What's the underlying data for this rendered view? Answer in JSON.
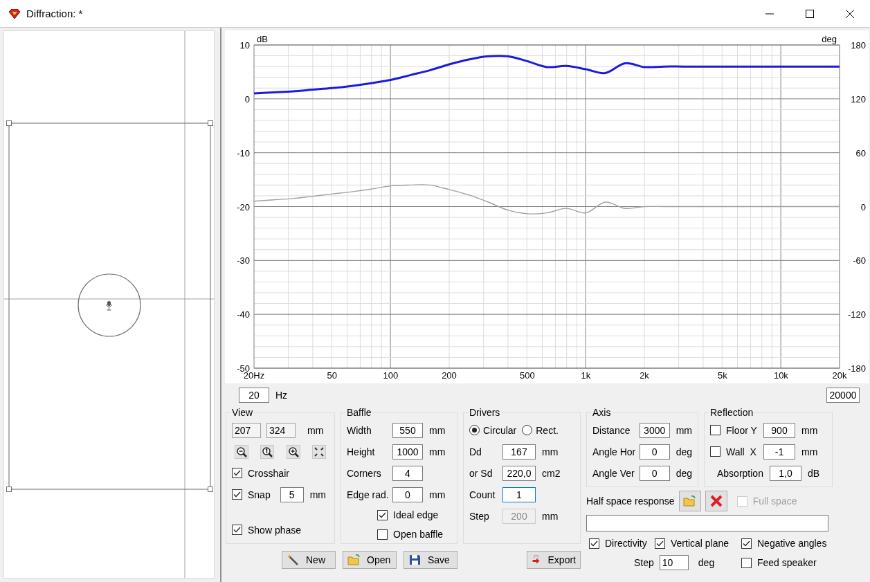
{
  "window": {
    "title": "Diffraction: *"
  },
  "chart": {
    "chart_data": {
      "type": "line",
      "grid": true,
      "ylabel": "dB",
      "y2label": "deg",
      "categories": [
        "20Hz",
        null,
        null,
        null,
        "50",
        null,
        null,
        "100",
        null,
        null,
        "200",
        null,
        null,
        null,
        "500",
        null,
        null,
        "1k",
        null,
        null,
        "2k",
        null,
        null,
        null,
        "5k",
        null,
        null,
        "10k",
        null,
        null,
        "20k"
      ],
      "series": [
        {
          "color": "#1a1ae0",
          "values": [
            1,
            1.2,
            1.4,
            1.7,
            2,
            2.4,
            2.9,
            3.5,
            4.4,
            5.3,
            6.4,
            7.3,
            7.9,
            7.9,
            7,
            5.9,
            6.1,
            5.5,
            4.8,
            6.6,
            5.9,
            6,
            6,
            6,
            6,
            6,
            6,
            6,
            6,
            6,
            6
          ]
        },
        {
          "color": "#a0a0a0",
          "axis": "y2",
          "values": [
            6,
            7.5,
            9,
            11.5,
            14,
            16.5,
            19.5,
            23,
            24,
            24,
            19,
            13,
            5,
            -4,
            -8,
            -7,
            -2,
            -7,
            5,
            -2,
            0,
            0,
            0,
            0,
            0,
            0,
            0,
            0,
            0,
            0,
            0
          ]
        }
      ],
      "ylim": [
        -50,
        10
      ],
      "y2lim": [
        -180,
        180
      ],
      "yticks": [
        10,
        0,
        -10,
        -20,
        -30,
        -40,
        -50
      ],
      "y2ticks": [
        180,
        120,
        60,
        0,
        -60,
        -120,
        -180
      ]
    }
  },
  "range": {
    "from": "20",
    "unit": "Hz",
    "to": "20000"
  },
  "groups": [
    {
      "title": "View",
      "rows": [
        {
          "kind": "pair",
          "values": [
            "207",
            "324"
          ],
          "unit": "mm"
        },
        {
          "kind": "tools"
        },
        {
          "kind": "check",
          "label": "Crosshair",
          "checked": true
        },
        {
          "kind": "check",
          "label": "Snap",
          "checked": true,
          "value": "5",
          "unit": "mm"
        },
        {
          "kind": "check",
          "label": "Show phase",
          "checked": true
        }
      ]
    },
    {
      "title": "Baffle",
      "rows": [
        {
          "kind": "field",
          "label": "Width",
          "value": "550",
          "unit": "mm"
        },
        {
          "kind": "field",
          "label": "Height",
          "value": "1000",
          "unit": "mm"
        },
        {
          "kind": "field",
          "label": "Corners",
          "value": "4"
        },
        {
          "kind": "field",
          "label": "Edge rad.",
          "value": "0",
          "unit": "mm"
        },
        {
          "kind": "check",
          "label": "Ideal edge",
          "checked": true
        },
        {
          "kind": "check",
          "label": "Open baffle",
          "checked": false
        }
      ]
    },
    {
      "title": "Drivers",
      "rows": [
        {
          "kind": "radio",
          "options": [
            {
              "label": "Circular",
              "selected": true
            },
            {
              "label": "Rect.",
              "selected": false
            }
          ]
        },
        {
          "kind": "field",
          "label": "Dd",
          "value": "167",
          "unit": "mm"
        },
        {
          "kind": "field",
          "label": "or Sd",
          "value": "220,0",
          "unit": "cm2"
        },
        {
          "kind": "field",
          "label": "Count",
          "value": "1",
          "focused": true
        },
        {
          "kind": "field",
          "label": "Step",
          "value": "200",
          "unit": "mm",
          "disabled": true
        }
      ]
    },
    {
      "title": "Axis",
      "rows": [
        {
          "kind": "field",
          "label": "Distance",
          "value": "3000",
          "unit": "mm"
        },
        {
          "kind": "field",
          "label": "Angle Hor",
          "value": "0",
          "unit": "deg"
        },
        {
          "kind": "field",
          "label": "Angle Ver",
          "value": "0",
          "unit": "deg"
        }
      ]
    },
    {
      "title": "Reflection",
      "rows": [
        {
          "kind": "field",
          "label": "Floor Y",
          "checked": false,
          "value": "900",
          "unit": "mm"
        },
        {
          "kind": "field",
          "label": "Wall  X",
          "checked": false,
          "value": "-1",
          "unit": "mm"
        },
        {
          "kind": "field",
          "label": "Absorption",
          "value": "1,0",
          "unit": "dB"
        }
      ]
    }
  ],
  "half_space": {
    "label": "Half space response",
    "full_space": {
      "label": "Full space",
      "checked": false,
      "disabled": true
    }
  },
  "options": [
    {
      "label": "Directivity",
      "checked": true
    },
    {
      "label": "Vertical plane",
      "checked": true
    },
    {
      "label": "Negative angles",
      "checked": true
    }
  ],
  "step": {
    "label": "Step",
    "value": "10",
    "unit": "deg"
  },
  "feed_speaker": {
    "label": "Feed speaker",
    "checked": false
  },
  "buttons": [
    {
      "kind": "new",
      "label": "New"
    },
    {
      "kind": "open",
      "label": "Open"
    },
    {
      "kind": "save",
      "label": "Save"
    }
  ],
  "export": {
    "label": "Export"
  }
}
